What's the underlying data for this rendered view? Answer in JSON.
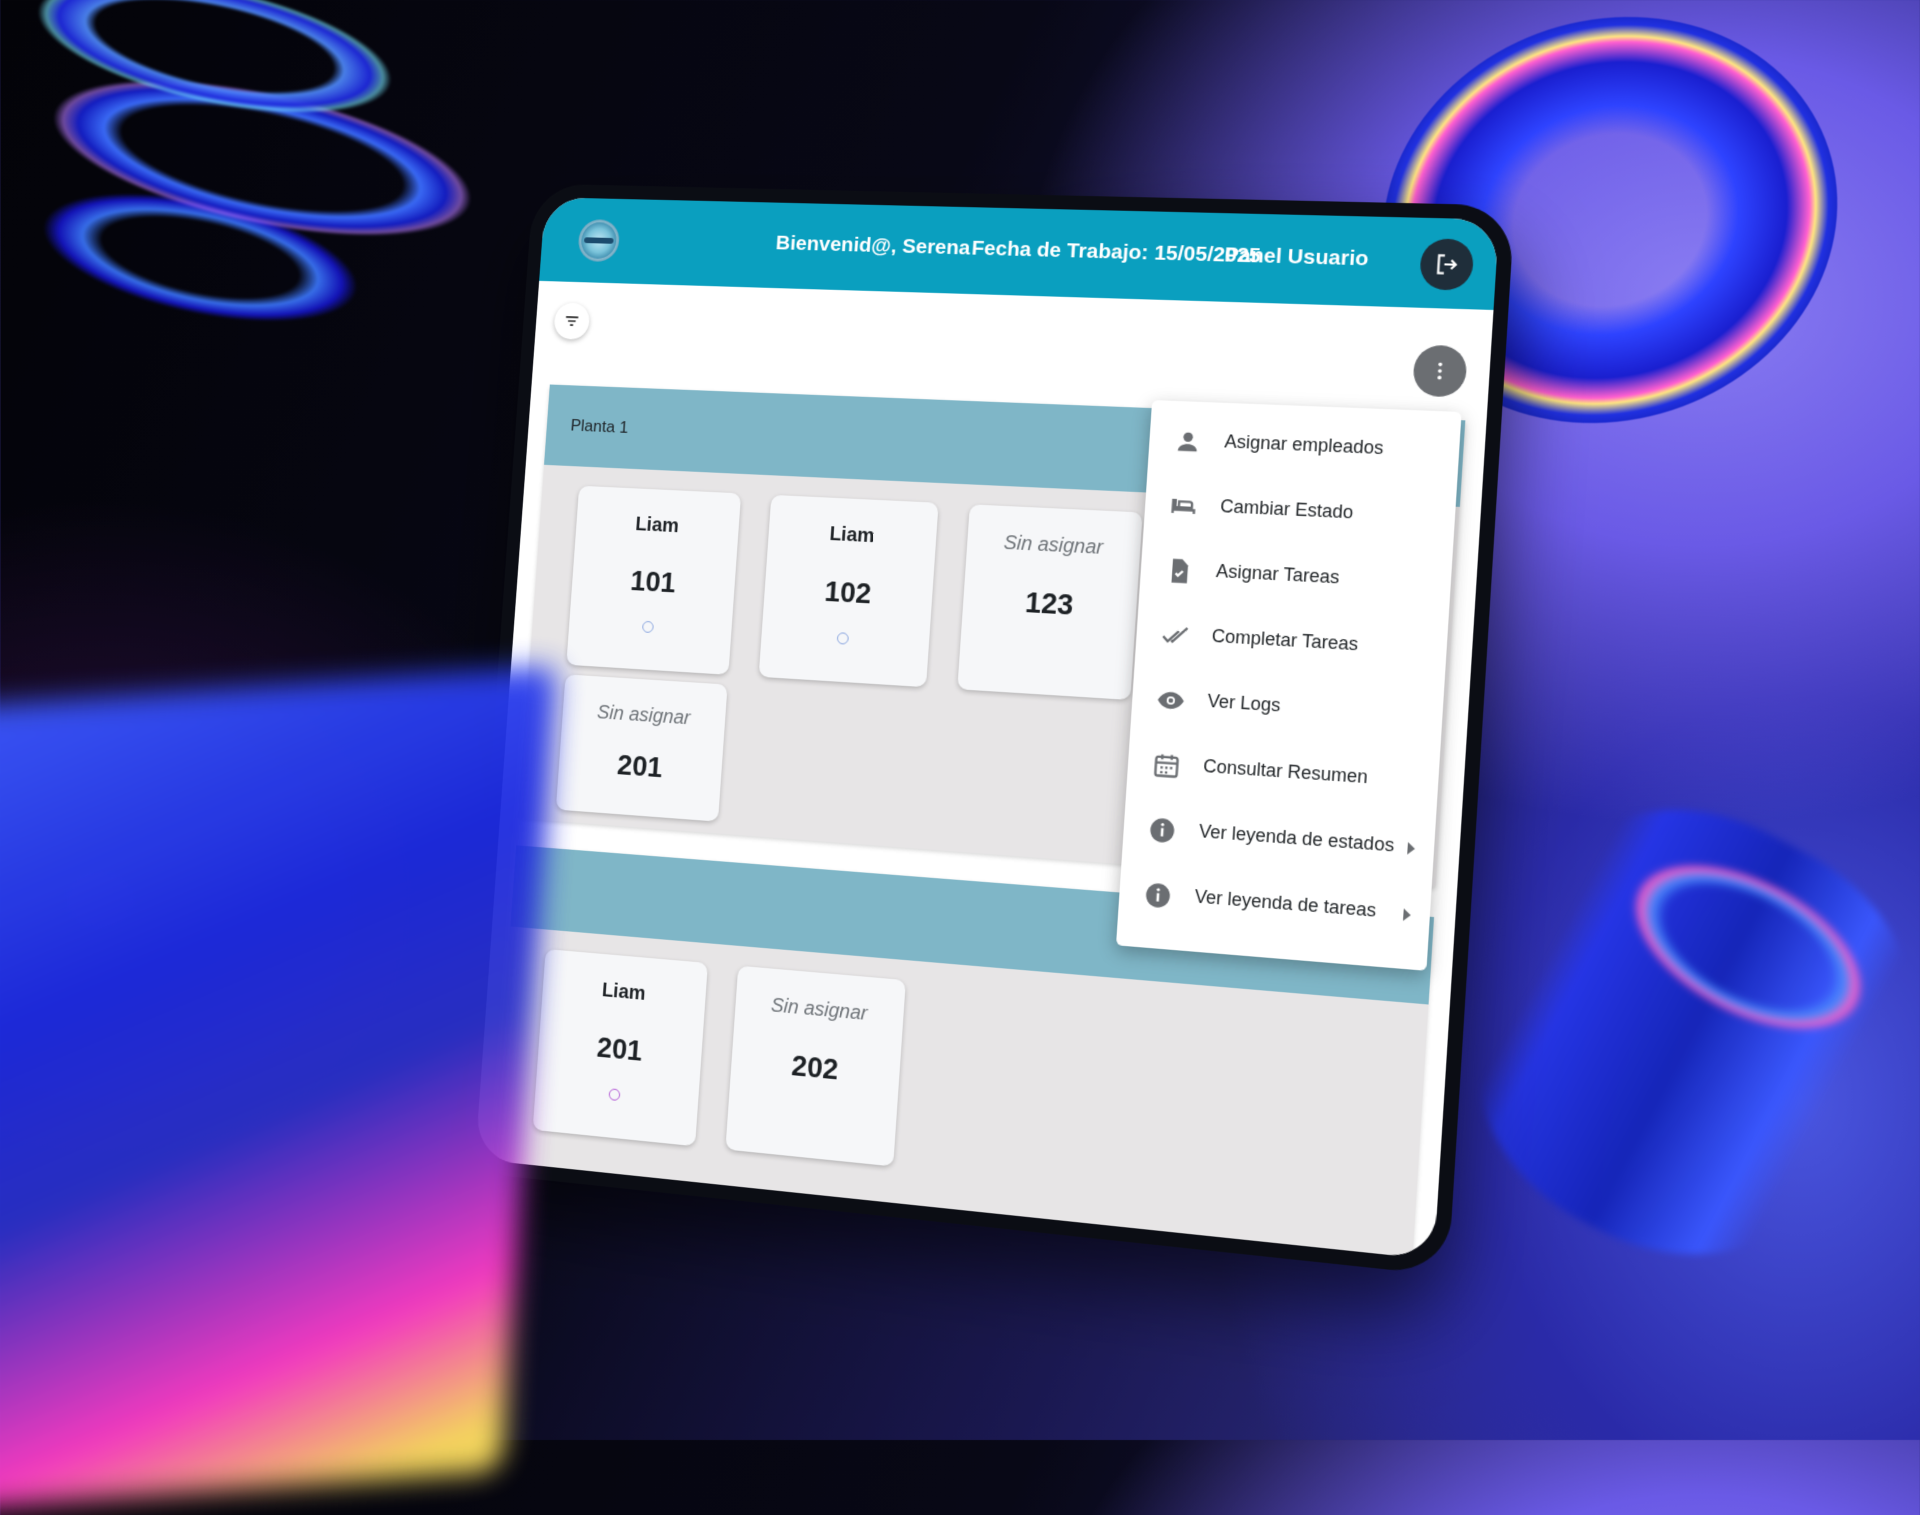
{
  "header": {
    "welcome": "Bienvenid@, Serena",
    "work_date": "Fecha de Trabajo: 15/05/2025",
    "panel": "Panel Usuario"
  },
  "sections": [
    {
      "title": "Planta 1",
      "rooms": [
        {
          "who": "Liam",
          "number": "101"
        },
        {
          "who": "Liam",
          "number": "102"
        },
        {
          "who": "Sin asignar",
          "number": "123"
        },
        {
          "who": "Sin asignar",
          "number": "201"
        }
      ]
    },
    {
      "title": "",
      "rooms": [
        {
          "who": "Liam",
          "number": "201"
        },
        {
          "who": "Sin asignar",
          "number": "202"
        }
      ]
    }
  ],
  "menu": {
    "items": [
      {
        "label": "Asignar empleados",
        "icon": "person-icon"
      },
      {
        "label": "Cambiar Estado",
        "icon": "bed-icon"
      },
      {
        "label": "Asignar Tareas",
        "icon": "task-file-icon"
      },
      {
        "label": "Completar Tareas",
        "icon": "double-check-icon"
      },
      {
        "label": "Ver Logs",
        "icon": "eye-icon"
      },
      {
        "label": "Consultar Resumen",
        "icon": "calendar-icon"
      },
      {
        "label": "Ver leyenda de estados",
        "icon": "info-icon"
      },
      {
        "label": "Ver leyenda de tareas",
        "icon": "info-icon"
      }
    ]
  },
  "colors": {
    "header": "#0a9fbf",
    "section_header": "#7fb6c7",
    "section_body": "#e7e5e6",
    "dark_button": "#1f2e3a"
  }
}
